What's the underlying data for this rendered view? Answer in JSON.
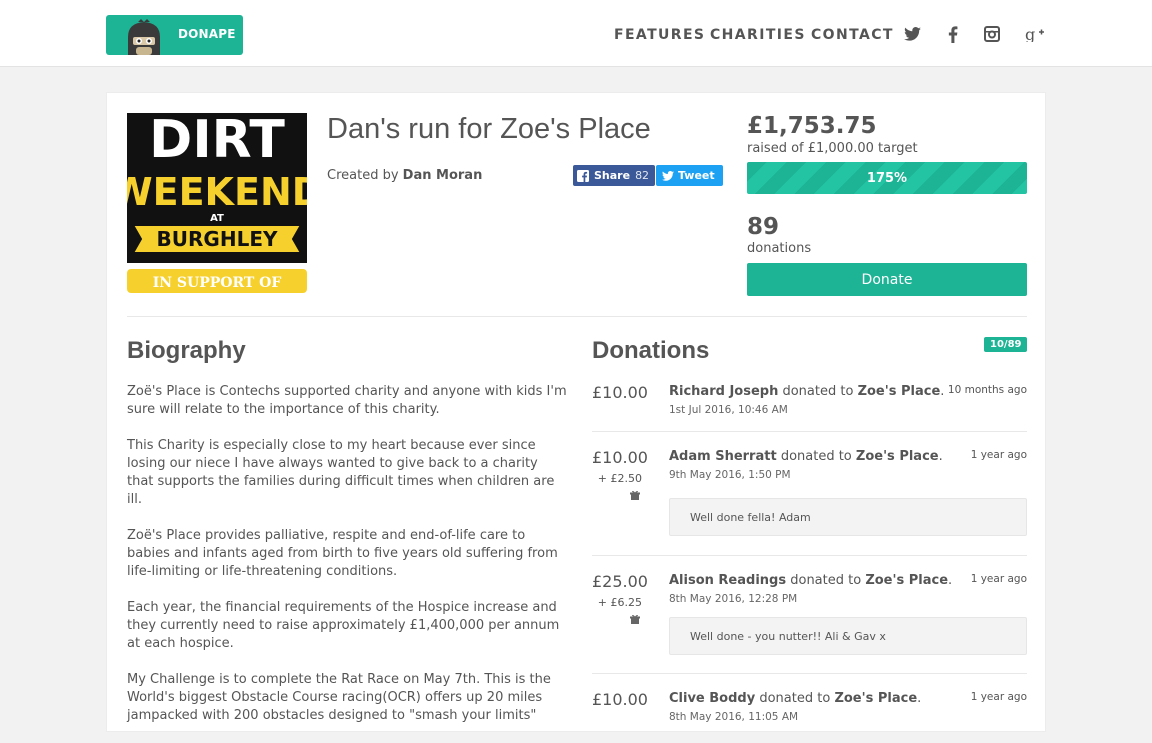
{
  "header": {
    "logo_text": "DONAPE",
    "nav": [
      "FEATURES",
      "CHARITIES",
      "CONTACT"
    ],
    "social": [
      "twitter-icon",
      "facebook-icon",
      "instagram-icon",
      "google-plus-icon"
    ]
  },
  "campaign": {
    "title": "Dan's run for Zoe's Place",
    "created_prefix": "Created by",
    "creator": "Dan Moran",
    "share_label": "Share",
    "share_count": "82",
    "tweet_label": "Tweet",
    "cover_lines": [
      "DIRT",
      "WEEKEND",
      "AT",
      "BURGHLEY",
      "IN SUPPORT OF"
    ]
  },
  "stats": {
    "raised": "£1,753.75",
    "raised_sub": "raised of £1,000.00 target",
    "progress_label": "175%",
    "progress_value": 1.75,
    "donations_count": "89",
    "donations_label": "donations",
    "donate_button": "Donate"
  },
  "biography": {
    "title": "Biography",
    "paragraphs": [
      "Zoë's Place is Contechs supported charity and anyone with kids I'm sure will relate to the importance of this charity.",
      "This Charity is especially close to my heart because ever since losing our niece I have always wanted to give back to a charity that supports the families during difficult times when children are ill.",
      "Zoë's Place provides palliative, respite and end-of-life care to babies and infants aged from birth to five years old suffering from life-limiting or life-threatening conditions.",
      "Each year, the financial requirements of the Hospice increase and they currently need to raise approximately £1,400,000 per annum at each hospice.",
      "My Challenge is to complete the Rat Race on May 7th. This is the World's biggest Obstacle Course racing(OCR) offers up 20 miles jampacked with 200 obstacles designed to \"smash your limits\""
    ]
  },
  "donations": {
    "title": "Donations",
    "badge": "10/89",
    "donated_to": "donated to",
    "items": [
      {
        "amount": "£10.00",
        "gift_aid": "",
        "name": "Richard Joseph",
        "charity": "Zoe's Place",
        "date": "1st Jul 2016, 10:46 AM",
        "ago": "10 months ago",
        "message": ""
      },
      {
        "amount": "£10.00",
        "gift_aid": "+ £2.50",
        "name": "Adam Sherratt",
        "charity": "Zoe's Place",
        "date": "9th May 2016, 1:50 PM",
        "ago": "1 year ago",
        "message": "Well done fella! Adam"
      },
      {
        "amount": "£25.00",
        "gift_aid": "+ £6.25",
        "name": "Alison Readings",
        "charity": "Zoe's Place",
        "date": "8th May 2016, 12:28 PM",
        "ago": "1 year ago",
        "message": "Well done - you nutter!! Ali & Gav x"
      },
      {
        "amount": "£10.00",
        "gift_aid": "",
        "name": "Clive Boddy",
        "charity": "Zoe's Place",
        "date": "8th May 2016, 11:05 AM",
        "ago": "1 year ago",
        "message": ""
      }
    ]
  }
}
